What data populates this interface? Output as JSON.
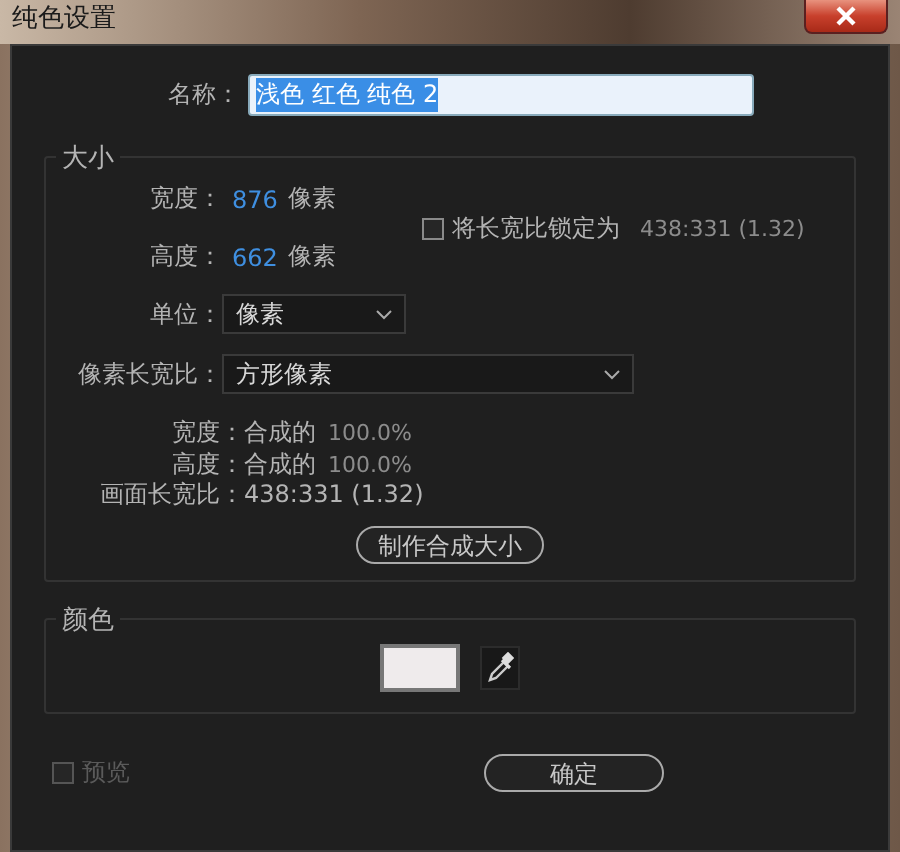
{
  "window": {
    "title": "纯色设置"
  },
  "name": {
    "label": "名称：",
    "value": "浅色 红色 纯色 2",
    "selected": true
  },
  "size": {
    "title": "大小",
    "dims": [
      {
        "label": "宽度：",
        "value": "876",
        "unit": "像素"
      },
      {
        "label": "高度：",
        "value": "662",
        "unit": "像素"
      }
    ],
    "lock_aspect": {
      "label": "将长宽比锁定为",
      "ratio": "438:331 (1.32)",
      "checked": false
    },
    "unit": {
      "label": "单位：",
      "value": "像素"
    },
    "pixel_aspect": {
      "label": "像素长宽比：",
      "value": "方形像素"
    },
    "info": [
      {
        "label": "宽度：",
        "value": "合成的",
        "extra": "100.0%"
      },
      {
        "label": "高度：",
        "value": "合成的",
        "extra": "100.0%"
      },
      {
        "label": "画面长宽比：",
        "value": "438:331 (1.32)"
      }
    ],
    "make_comp_size_button": "制作合成大小"
  },
  "color": {
    "title": "颜色",
    "swatch": {
      "color": "#efebec"
    }
  },
  "preview": {
    "label": "预览",
    "checked": false,
    "disabled": true
  },
  "ok_button": "确定"
}
